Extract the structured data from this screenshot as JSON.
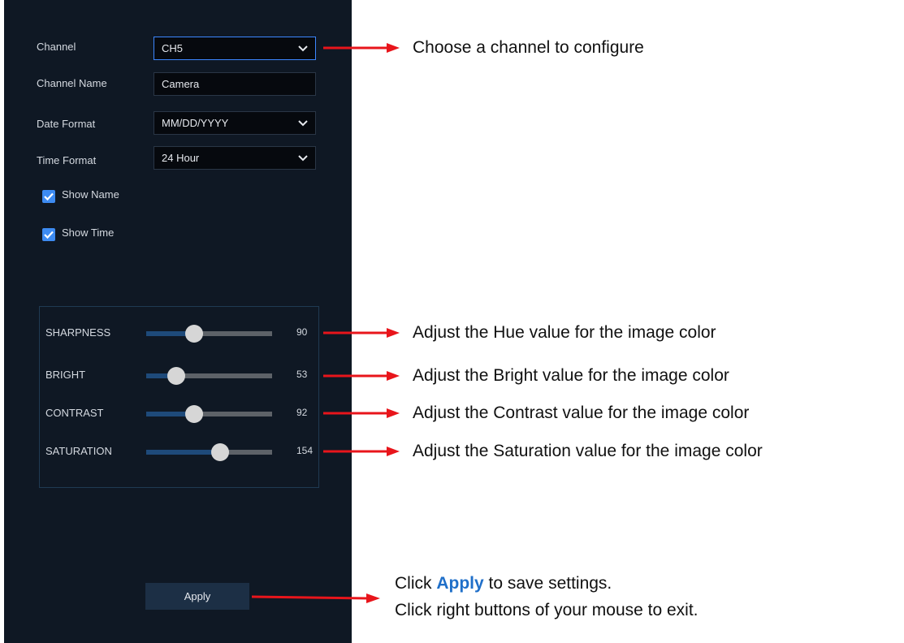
{
  "form": {
    "channel": {
      "label": "Channel",
      "value": "CH5"
    },
    "channel_name": {
      "label": "Channel Name",
      "value": "Camera"
    },
    "date_format": {
      "label": "Date Format",
      "value": "MM/DD/YYYY"
    },
    "time_format": {
      "label": "Time Format",
      "value": "24 Hour"
    },
    "show_name": {
      "label": "Show Name",
      "checked": true
    },
    "show_time": {
      "label": "Show Time",
      "checked": true
    }
  },
  "sliders": [
    {
      "label": "SHARPNESS",
      "value": "90",
      "level": 0.38
    },
    {
      "label": "BRIGHT",
      "value": "53",
      "level": 0.24
    },
    {
      "label": "CONTRAST",
      "value": "92",
      "level": 0.38
    },
    {
      "label": "SATURATION",
      "value": "154",
      "level": 0.59
    }
  ],
  "apply_label": "Apply",
  "annotations": {
    "channel": "Choose a channel to configure",
    "sharpness": "Adjust the Hue value for the image color",
    "bright": "Adjust the Bright value for the image color",
    "contrast": "Adjust the Contrast value for the image color",
    "saturation": "Adjust the Saturation value for the image color",
    "apply_prefix": "Click ",
    "apply_word": "Apply",
    "apply_suffix": " to save settings.",
    "exit": "Click right buttons of your mouse to exit."
  },
  "colors": {
    "panel": "#0f1824",
    "accent": "#3c86ff",
    "arrow": "#e8151b",
    "apply_highlight": "#1f6fc9"
  }
}
